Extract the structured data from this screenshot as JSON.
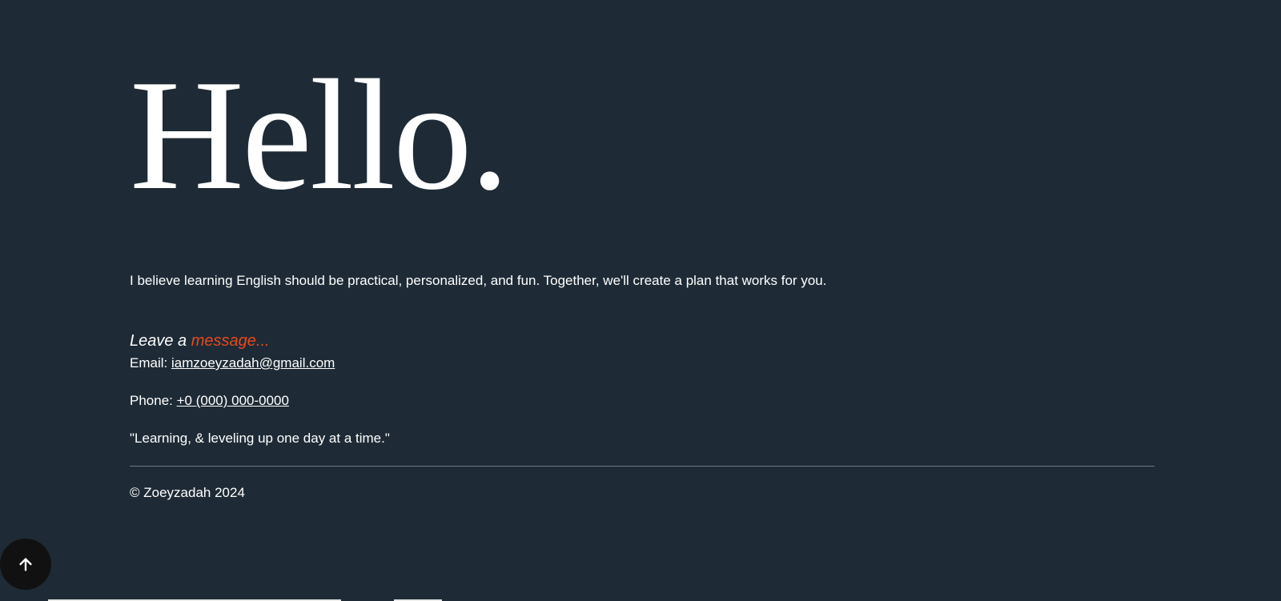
{
  "hero": {
    "title": "Hello."
  },
  "intro": {
    "text": "I believe learning English should be practical, personalized, and fun. Together, we'll create a plan that works for you."
  },
  "message": {
    "prefix": "Leave a ",
    "accent": "message...",
    "accent_color": "#e8491d"
  },
  "contact": {
    "email_label": "Email: ",
    "email_value": "iamzoeyzadah@gmail.com",
    "phone_label": "Phone: ",
    "phone_value": "+0 (000) 000-0000",
    "quote": "\"Learning, & leveling up one day at a time.\""
  },
  "footer": {
    "copyright": "© Zoeyzadah 2024"
  },
  "back_to_top": {
    "icon": "arrow-up-icon"
  },
  "colors": {
    "background": "#1e2b36",
    "text": "#ffffff",
    "accent": "#e8491d",
    "button": "#111111"
  }
}
